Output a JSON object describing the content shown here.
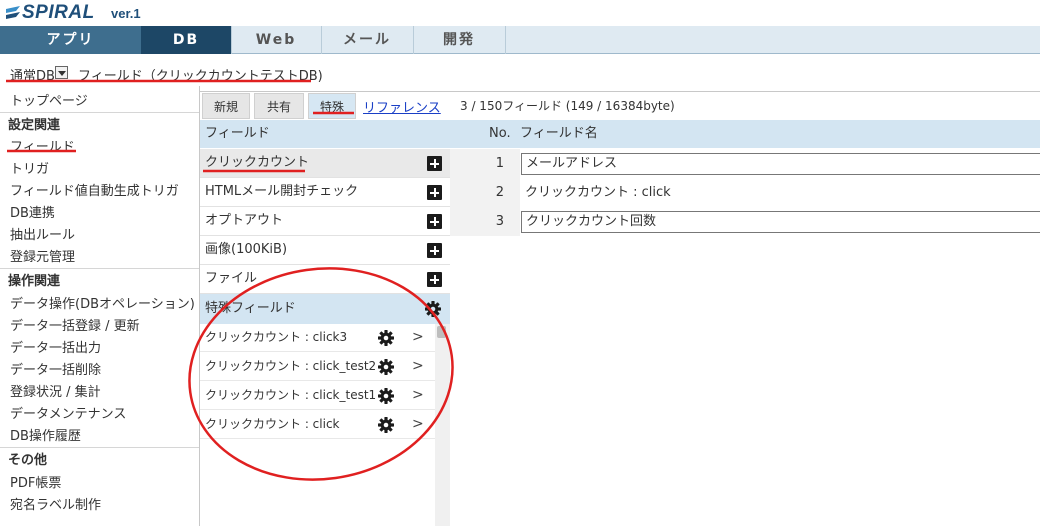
{
  "app": {
    "brand": "SPIRAL",
    "version": "ver.1"
  },
  "tabs": [
    "アプリ",
    "DB",
    "Web",
    "メール",
    "開発"
  ],
  "breadcrumb": {
    "db_label": "通常DB",
    "title": "フィールド（クリックカウントテストDB)"
  },
  "sidebar": {
    "items_top": [
      "トップページ"
    ],
    "section_settings": "設定関連",
    "settings_items": [
      "フィールド",
      "トリガ",
      "フィールド値自動生成トリガ",
      "DB連携",
      "抽出ルール",
      "登録元管理"
    ],
    "section_ops": "操作関連",
    "ops_items": [
      "データ操作(DBオペレーション)",
      "データ一括登録 / 更新",
      "データ一括出力",
      "データ一括削除",
      "登録状況 / 集計",
      "データメンテナンス",
      "DB操作履歴"
    ],
    "section_other": "その他",
    "other_items": [
      "PDF帳票",
      "宛名ラベル制作"
    ]
  },
  "content_tabs": [
    "新規",
    "共有",
    "特殊"
  ],
  "reference_link": "リファレンス",
  "field_count": "3 / 150フィールド (149 / 16384byte)",
  "field_list": {
    "header": "フィールド",
    "items": [
      "クリックカウント",
      "HTMLメール開封チェック",
      "オプトアウト",
      "画像(100KiB)",
      "ファイル"
    ]
  },
  "special": {
    "header": "特殊フィールド",
    "items": [
      "クリックカウント : click3",
      "クリックカウント : click_test2",
      "クリックカウント : click_test1",
      "クリックカウント : click"
    ],
    "arrow": ">"
  },
  "table": {
    "col_no": "No.",
    "col_name": "フィールド名",
    "rows": [
      {
        "no": "1",
        "name": "メールアドレス"
      },
      {
        "no": "2",
        "name": "クリックカウント : click"
      },
      {
        "no": "3",
        "name": "クリックカウント回数"
      }
    ]
  },
  "colors": {
    "active_tab": "#1d4766",
    "header_blue": "#d3e5f2",
    "annotation_red": "#e02020",
    "link": "#1a3fc6"
  },
  "icons": [
    "spiral-logo-icon",
    "dropdown-arrow-icon",
    "plus-icon",
    "gear-icon",
    "chevron-right-icon"
  ]
}
